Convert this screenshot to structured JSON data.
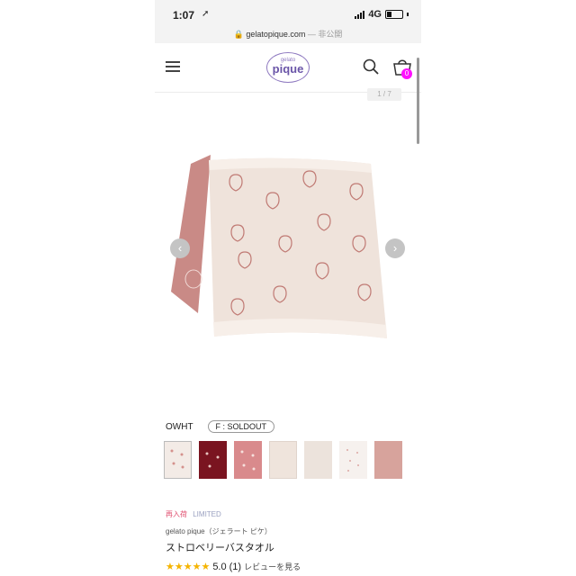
{
  "status_bar": {
    "time": "1:07",
    "location_icon": "location-arrow-icon",
    "network": "4G"
  },
  "url_bar": {
    "domain": "gelatopique.com",
    "suffix": "— 非公開"
  },
  "header": {
    "logo_small": "gelato",
    "logo_big": "pique",
    "cart_count": "0"
  },
  "gallery": {
    "counter": "1 / 7",
    "prev": "‹",
    "next": "›"
  },
  "variant": {
    "color": "OWHT",
    "size_status": "F : SOLDOUT"
  },
  "thumbnails": [
    "owht",
    "dark-red",
    "pink",
    "owht-folded",
    "owht-plain",
    "white-dots",
    "pink-plain"
  ],
  "product": {
    "tag_new": "再入荷",
    "tag_limited": "LIMITED",
    "brand": "gelato pique（ジェラート ピケ）",
    "name": "ストロベリーバスタオル",
    "stars": "★★★★★",
    "rating": "5.0",
    "review_count": "(1)",
    "review_link": "レビューを見る"
  },
  "colors": {
    "accent": "#ff10ff",
    "logo": "#6a55a8",
    "star": "#f5b400"
  }
}
